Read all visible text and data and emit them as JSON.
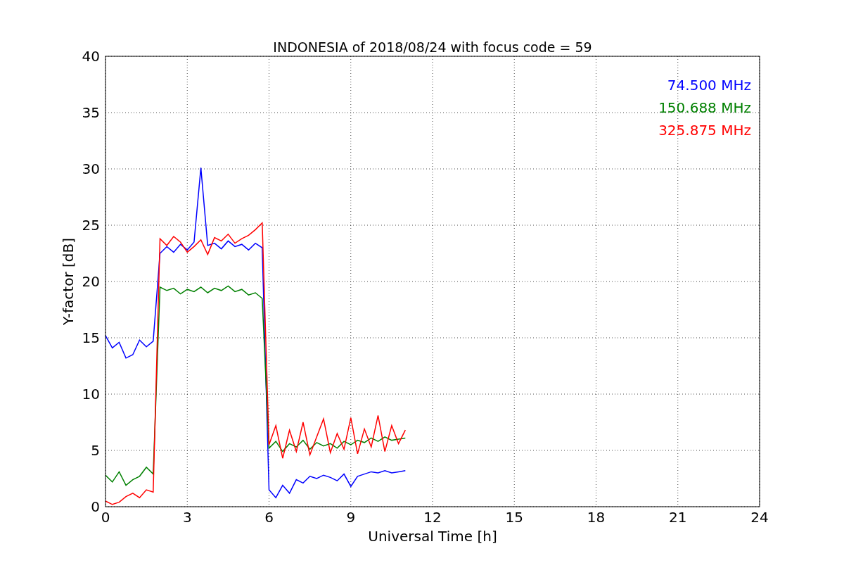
{
  "figure": {
    "chart_data": {
      "type": "line",
      "title": "INDONESIA of 2018/08/24 with focus code = 59",
      "xlabel": "Universal Time [h]",
      "ylabel": "Y-factor [dB]",
      "x": [
        0,
        0.25,
        0.5,
        0.75,
        1,
        1.25,
        1.5,
        1.75,
        2,
        2.25,
        2.5,
        2.75,
        3,
        3.25,
        3.5,
        3.75,
        4,
        4.25,
        4.5,
        4.75,
        5,
        5.25,
        5.5,
        5.75,
        6,
        6.25,
        6.5,
        6.75,
        7,
        7.25,
        7.5,
        7.75,
        8,
        8.25,
        8.5,
        8.75,
        9,
        9.25,
        9.5,
        9.75,
        10,
        10.25,
        10.5,
        10.75,
        11
      ],
      "series": [
        {
          "name": "74.500 MHz",
          "color": "#0000ff",
          "values": [
            15.2,
            14.1,
            14.6,
            13.2,
            13.5,
            14.8,
            14.2,
            14.7,
            22.5,
            23.1,
            22.6,
            23.3,
            22.8,
            23.5,
            30.1,
            23.2,
            23.4,
            22.9,
            23.6,
            23.1,
            23.3,
            22.8,
            23.4,
            23.0,
            1.5,
            0.8,
            1.9,
            1.2,
            2.4,
            2.1,
            2.7,
            2.5,
            2.8,
            2.6,
            2.3,
            2.9,
            1.8,
            2.7,
            2.9,
            3.1,
            3.0,
            3.2,
            3.0,
            3.1,
            3.2
          ]
        },
        {
          "name": "150.688 MHz",
          "color": "#008000",
          "values": [
            2.8,
            2.2,
            3.1,
            1.9,
            2.4,
            2.7,
            3.5,
            2.9,
            19.5,
            19.2,
            19.4,
            18.9,
            19.3,
            19.1,
            19.5,
            19.0,
            19.4,
            19.2,
            19.6,
            19.1,
            19.3,
            18.8,
            19.0,
            18.5,
            5.2,
            5.8,
            4.9,
            5.6,
            5.3,
            5.9,
            5.1,
            5.7,
            5.4,
            5.6,
            5.2,
            5.8,
            5.5,
            5.9,
            5.7,
            6.1,
            5.8,
            6.2,
            5.9,
            6.0,
            6.1
          ]
        },
        {
          "name": "325.875 MHz",
          "color": "#ff0000",
          "values": [
            0.5,
            0.2,
            0.4,
            0.9,
            1.2,
            0.8,
            1.5,
            1.3,
            23.8,
            23.2,
            24.0,
            23.5,
            22.6,
            23.1,
            23.7,
            22.4,
            23.9,
            23.6,
            24.2,
            23.4,
            23.8,
            24.1,
            24.6,
            25.2,
            5.5,
            7.2,
            4.3,
            6.8,
            4.9,
            7.5,
            4.6,
            6.2,
            7.8,
            4.8,
            6.5,
            5.1,
            7.9,
            4.7,
            6.9,
            5.3,
            8.1,
            4.9,
            7.2,
            5.6,
            6.8
          ]
        }
      ],
      "grid": true,
      "xlim": [
        0,
        24
      ],
      "ylim": [
        0,
        40
      ],
      "xticks": [
        0,
        3,
        6,
        9,
        12,
        15,
        18,
        21,
        24
      ],
      "yticks": [
        0,
        5,
        10,
        15,
        20,
        25,
        30,
        35,
        40
      ]
    }
  }
}
